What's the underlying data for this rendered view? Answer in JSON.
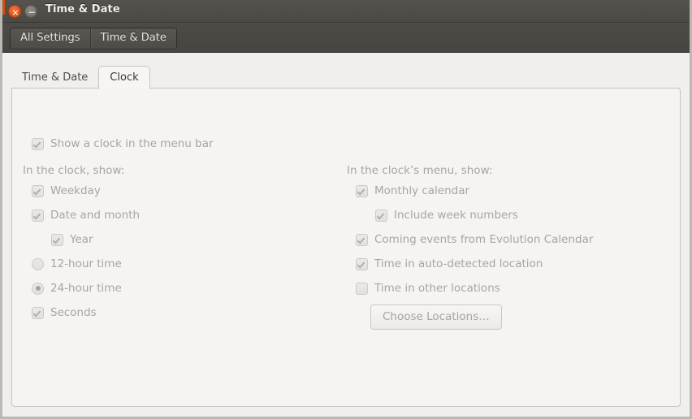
{
  "window": {
    "title": "Time & Date",
    "close_glyph": "×",
    "minimize_glyph": "−"
  },
  "toolbar": {
    "breadcrumbs": [
      {
        "label": "All Settings"
      },
      {
        "label": "Time & Date"
      }
    ]
  },
  "tabs": [
    {
      "label": "Time & Date",
      "active": false
    },
    {
      "label": "Clock",
      "active": true
    }
  ],
  "panel": {
    "show_clock_in_menu_bar": {
      "label": "Show a clock in the menu bar",
      "checked": true,
      "enabled": false
    },
    "left_column": {
      "heading": "In the clock, show:",
      "items": [
        {
          "type": "checkbox",
          "label": "Weekday",
          "checked": true,
          "indent": 0
        },
        {
          "type": "checkbox",
          "label": "Date and month",
          "checked": true,
          "indent": 0
        },
        {
          "type": "checkbox",
          "label": "Year",
          "checked": true,
          "indent": 1
        },
        {
          "type": "radio",
          "label": "12-hour time",
          "selected": false,
          "indent": 0
        },
        {
          "type": "radio",
          "label": "24-hour time",
          "selected": true,
          "indent": 0
        },
        {
          "type": "checkbox",
          "label": "Seconds",
          "checked": true,
          "indent": 0
        }
      ]
    },
    "right_column": {
      "heading": "In the clock’s menu, show:",
      "items": [
        {
          "type": "checkbox",
          "label": "Monthly calendar",
          "checked": true,
          "indent": 0
        },
        {
          "type": "checkbox",
          "label": "Include week numbers",
          "checked": true,
          "indent": 1
        },
        {
          "type": "checkbox",
          "label": "Coming events from Evolution Calendar",
          "checked": true,
          "indent": 0
        },
        {
          "type": "checkbox",
          "label": "Time in auto-detected location",
          "checked": true,
          "indent": 0
        },
        {
          "type": "checkbox",
          "label": "Time in other locations",
          "checked": false,
          "indent": 0
        }
      ],
      "button": {
        "label": "Choose Locations…"
      }
    }
  },
  "colors": {
    "titlebar": "#4c4a46",
    "close_button": "#e0561f",
    "accent_strip": "#d24f14",
    "panel_background": "#f5f4f3",
    "content_background": "#f0efee",
    "disabled_text": "#a8a5a0"
  }
}
